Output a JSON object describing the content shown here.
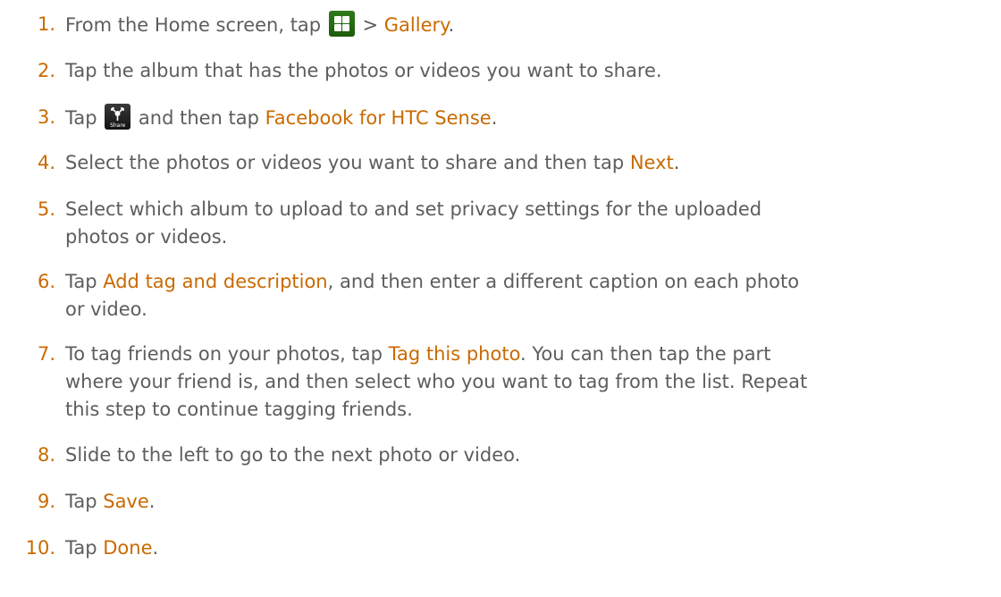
{
  "steps": [
    {
      "number": "1.",
      "before": "From the Home screen, tap ",
      "icon": "apps-grid-icon",
      "after": " > ",
      "emph": "Gallery",
      "end": "."
    },
    {
      "number": "2.",
      "text": "Tap the album that has the photos or videos you want to share."
    },
    {
      "number": "3.",
      "before": "Tap ",
      "icon": "share-icon",
      "icon_caption": "Share",
      "after": " and then tap ",
      "emph": "Facebook for HTC Sense",
      "end": "."
    },
    {
      "number": "4.",
      "before": "Select the photos or videos you want to share and then tap ",
      "emph": "Next",
      "end": "."
    },
    {
      "number": "5.",
      "line1": "Select which album to upload to and set privacy settings for the uploaded",
      "line2": "photos or videos."
    },
    {
      "number": "6.",
      "before": "Tap ",
      "emph": "Add tag and description",
      "after": ", and then enter a different caption on each photo",
      "line2": "or video."
    },
    {
      "number": "7.",
      "before": "To tag friends on your photos, tap ",
      "emph": "Tag this photo",
      "after": ". You can then tap the part",
      "line2": "where your friend is, and then select who you want to tag from the list. Repeat",
      "line3": "this step to continue tagging friends."
    },
    {
      "number": "8.",
      "text": "Slide to the left to go to the next photo or video."
    },
    {
      "number": "9.",
      "before": "Tap ",
      "emph": "Save",
      "end": "."
    },
    {
      "number": "10.",
      "before": "Tap ",
      "emph": "Done",
      "end": "."
    }
  ],
  "colors": {
    "accent": "#c96a00",
    "text": "#5d5d5d"
  }
}
